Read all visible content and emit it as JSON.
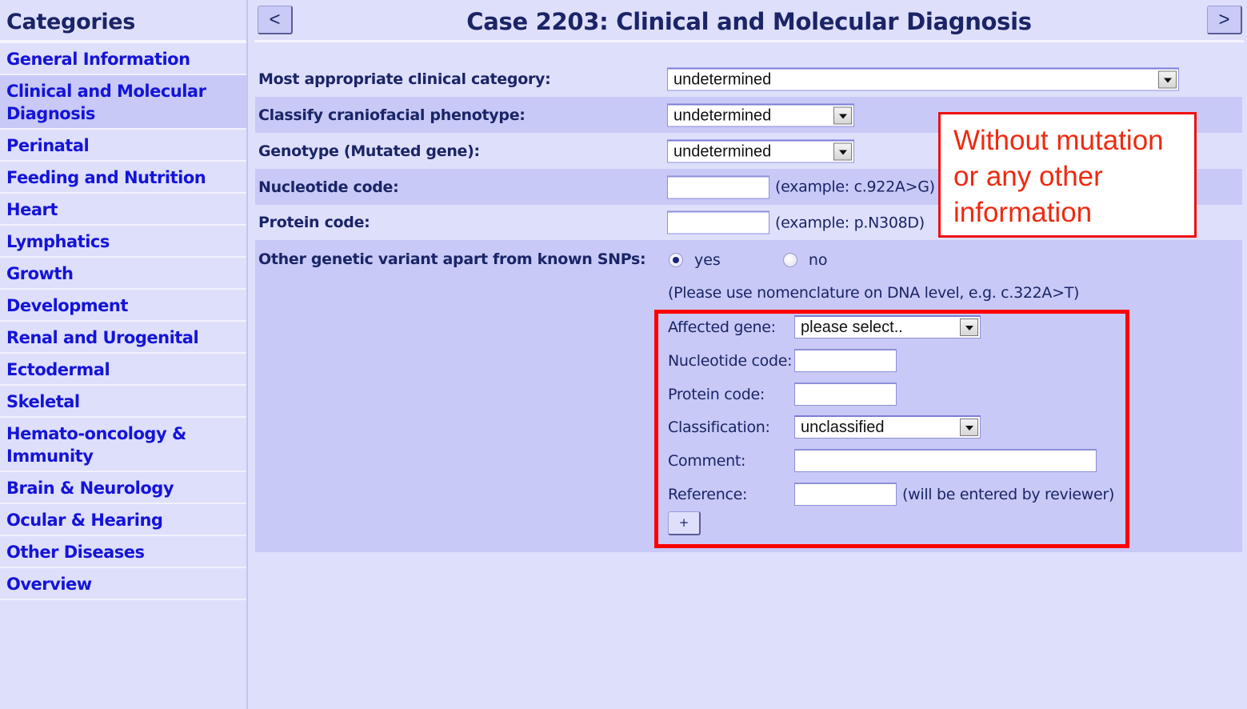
{
  "sidebar": {
    "title": "Categories",
    "active_index": 1,
    "items": [
      {
        "label": "General Information"
      },
      {
        "label": "Clinical and Molecular Diagnosis"
      },
      {
        "label": "Perinatal"
      },
      {
        "label": "Feeding and Nutrition"
      },
      {
        "label": "Heart"
      },
      {
        "label": "Lymphatics"
      },
      {
        "label": "Growth"
      },
      {
        "label": "Development"
      },
      {
        "label": "Renal and Urogenital"
      },
      {
        "label": "Ectodermal"
      },
      {
        "label": "Skeletal"
      },
      {
        "label": "Hemato-oncology & Immunity"
      },
      {
        "label": "Brain & Neurology"
      },
      {
        "label": "Ocular & Hearing"
      },
      {
        "label": "Other Diseases"
      },
      {
        "label": "Overview"
      }
    ]
  },
  "header": {
    "prev_label": "<",
    "next_label": ">",
    "title": "Case 2203: Clinical and Molecular Diagnosis"
  },
  "form": {
    "clinical_category": {
      "label": "Most appropriate clinical category:",
      "value": "undetermined"
    },
    "craniofacial": {
      "label": "Classify craniofacial phenotype:",
      "value": "undetermined"
    },
    "genotype": {
      "label": "Genotype (Mutated gene):",
      "value": "undetermined"
    },
    "nucleotide": {
      "label": "Nucleotide code:",
      "value": "",
      "hint": "(example: c.922A>G)"
    },
    "protein": {
      "label": "Protein code:",
      "value": "",
      "hint": "(example: p.N308D)"
    },
    "other_variant": {
      "label": "Other genetic variant apart from known SNPs:",
      "options": [
        {
          "label": "yes",
          "checked": true
        },
        {
          "label": "no",
          "checked": false
        }
      ],
      "note": "(Please use nomenclature on DNA level, e.g. c.322A>T)"
    },
    "variant": {
      "affected_gene": {
        "label": "Affected gene:",
        "value": "please select.."
      },
      "nucleotide": {
        "label": "Nucleotide code:",
        "value": ""
      },
      "protein": {
        "label": "Protein code:",
        "value": ""
      },
      "classification": {
        "label": "Classification:",
        "value": "unclassified"
      },
      "comment": {
        "label": "Comment:",
        "value": ""
      },
      "reference": {
        "label": "Reference:",
        "value": "",
        "hint": "(will be entered by reviewer)"
      },
      "add_label": "+"
    }
  },
  "annotation": {
    "text": "Without mutation or any other information",
    "color": "#ee2a10",
    "highlight_color": "#ff0000"
  }
}
